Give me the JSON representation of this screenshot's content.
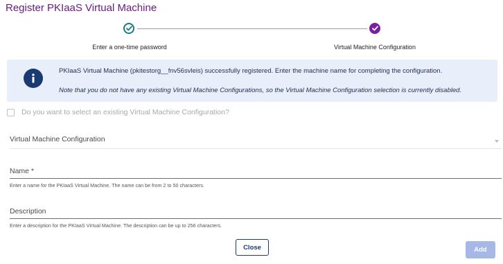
{
  "dialog": {
    "title": "Register PKIaaS Virtual Machine"
  },
  "stepper": {
    "steps": [
      {
        "label": "Enter a one-time password",
        "state": "completed",
        "icon": "check-outline-icon"
      },
      {
        "label": "Virtual Machine Configuration",
        "state": "active",
        "icon": "check-filled-icon"
      }
    ]
  },
  "info": {
    "icon": "info-icon",
    "message": "PKIaaS Virtual Machine (pkitestorg__fnv56svleis) successfully registered. Enter the machine name for completing the configuration.",
    "note": "Note that you do not have any existing Virtual Machine Configurations, so the Virtual Machine Configuration selection is currently disabled."
  },
  "form": {
    "existing_config_checkbox": {
      "label": "Do you want to select an existing Virtual Machine Configuration?",
      "checked": false,
      "disabled": true
    },
    "vm_config_select": {
      "label": "Virtual Machine Configuration",
      "disabled": true
    },
    "name": {
      "label": "Name *",
      "value": "",
      "helper": "Enter a name for the PKIaaS Virtual Machine. The name can be from 2 to 50 characters."
    },
    "description": {
      "label": "Description",
      "value": "",
      "helper": "Enter a description for the PKIaaS Virtual Machine. The description can be up to 256 characters."
    }
  },
  "actions": {
    "close_label": "Close",
    "add_label": "Add",
    "add_disabled": true
  },
  "colors": {
    "title": "#6a1b7d",
    "step_completed": "#1c7a82",
    "step_active": "#7b1fa2",
    "info_background": "#e8eefa",
    "info_icon": "#1a3a72",
    "primary_disabled": "#a5b8e6"
  }
}
